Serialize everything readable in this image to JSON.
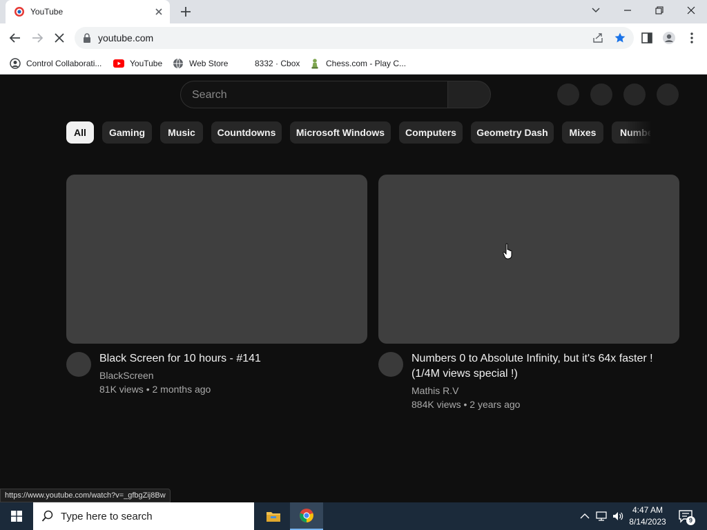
{
  "browser": {
    "tab_title": "YouTube",
    "url": "youtube.com",
    "status_url": "https://www.youtube.com/watch?v=_gfbgZij8Bw"
  },
  "bookmarks": [
    {
      "label": "Control Collaborati...",
      "icon": "person-circle-icon"
    },
    {
      "label": "YouTube",
      "icon": "youtube-icon"
    },
    {
      "label": "Web Store",
      "icon": "globe-icon"
    },
    {
      "label": "8332 · Cbox",
      "icon": ""
    },
    {
      "label": "Chess.com - Play C...",
      "icon": "chess-pawn-icon"
    }
  ],
  "youtube": {
    "search_placeholder": "Search",
    "chips": [
      "All",
      "Gaming",
      "Music",
      "Countdowns",
      "Microsoft Windows",
      "Computers",
      "Geometry Dash",
      "Mixes",
      "Numbe"
    ],
    "active_chip": "All",
    "videos": [
      {
        "title": "Black Screen for 10 hours - #141",
        "channel": "BlackScreen",
        "meta": "81K views • 2 months ago"
      },
      {
        "title": "Numbers 0 to Absolute Infinity, but it's 64x faster ! (1/4M views special !)",
        "channel": "Mathis R.V",
        "meta": "884K views • 2 years ago"
      }
    ]
  },
  "taskbar": {
    "search_placeholder": "Type here to search",
    "time": "4:47 AM",
    "date": "8/14/2023",
    "notification_count": "9"
  },
  "colors": {
    "page_bg": "#0f0f0f",
    "chip_bg": "#272727",
    "chip_active_bg": "#f1f1f1",
    "thumbnail_placeholder": "#3f3f3f",
    "bookmark_star": "#1a73e8",
    "taskbar_bg": "#1b2a3a"
  }
}
